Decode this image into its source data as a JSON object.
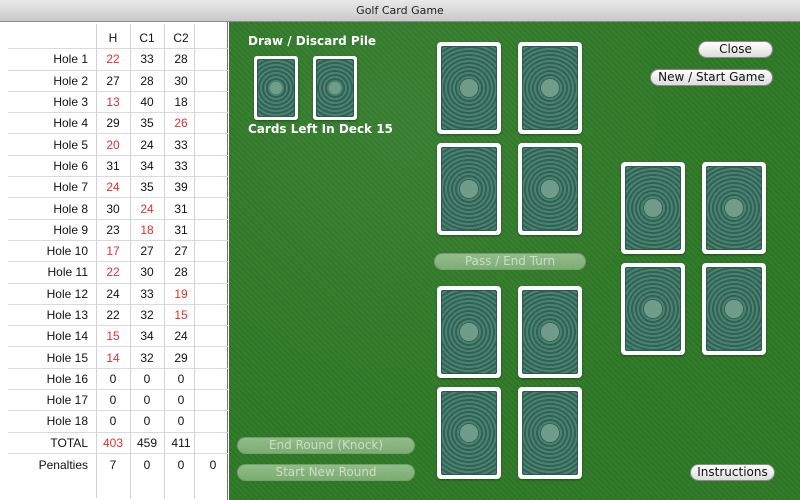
{
  "window": {
    "title": "Golf Card Game"
  },
  "scoreboard": {
    "columns": [
      "H",
      "C1",
      "C2"
    ],
    "rows": [
      {
        "label": "Hole 1",
        "h": "22",
        "c1": "33",
        "c2": "28",
        "red": "h"
      },
      {
        "label": "Hole 2",
        "h": "27",
        "c1": "28",
        "c2": "30",
        "red": ""
      },
      {
        "label": "Hole 3",
        "h": "13",
        "c1": "40",
        "c2": "18",
        "red": "h"
      },
      {
        "label": "Hole 4",
        "h": "29",
        "c1": "35",
        "c2": "26",
        "red": "c2"
      },
      {
        "label": "Hole 5",
        "h": "20",
        "c1": "24",
        "c2": "33",
        "red": "h"
      },
      {
        "label": "Hole 6",
        "h": "31",
        "c1": "34",
        "c2": "33",
        "red": ""
      },
      {
        "label": "Hole 7",
        "h": "24",
        "c1": "35",
        "c2": "39",
        "red": "h"
      },
      {
        "label": "Hole 8",
        "h": "30",
        "c1": "24",
        "c2": "31",
        "red": "c1"
      },
      {
        "label": "Hole 9",
        "h": "23",
        "c1": "18",
        "c2": "31",
        "red": "c1"
      },
      {
        "label": "Hole 10",
        "h": "17",
        "c1": "27",
        "c2": "27",
        "red": "h"
      },
      {
        "label": "Hole 11",
        "h": "22",
        "c1": "30",
        "c2": "28",
        "red": "h"
      },
      {
        "label": "Hole 12",
        "h": "24",
        "c1": "33",
        "c2": "19",
        "red": "c2"
      },
      {
        "label": "Hole 13",
        "h": "22",
        "c1": "32",
        "c2": "15",
        "red": "c2"
      },
      {
        "label": "Hole 14",
        "h": "15",
        "c1": "34",
        "c2": "24",
        "red": "h"
      },
      {
        "label": "Hole 15",
        "h": "14",
        "c1": "32",
        "c2": "29",
        "red": "h"
      },
      {
        "label": "Hole 16",
        "h": "0",
        "c1": "0",
        "c2": "0",
        "red": ""
      },
      {
        "label": "Hole 17",
        "h": "0",
        "c1": "0",
        "c2": "0",
        "red": ""
      },
      {
        "label": "Hole 18",
        "h": "0",
        "c1": "0",
        "c2": "0",
        "red": ""
      }
    ],
    "total": {
      "label": "TOTAL",
      "h": "403",
      "c1": "459",
      "c2": "411"
    },
    "penalties": {
      "label": "Penalties",
      "h": "7",
      "c1": "0",
      "c2": "0",
      "extra": "0"
    }
  },
  "table": {
    "draw_discard_label": "Draw / Discard Pile",
    "deck_count_text": "Cards Left In Deck 15"
  },
  "buttons": {
    "close": "Close",
    "new_game": "New / Start Game",
    "pass_end_turn": "Pass / End Turn",
    "end_round": "End Round (Knock)",
    "start_new_round": "Start New Round",
    "instructions": "Instructions"
  },
  "colors": {
    "felt": "#2f7a27",
    "winner_score": "#e23030",
    "card_back": "#3d7262"
  }
}
